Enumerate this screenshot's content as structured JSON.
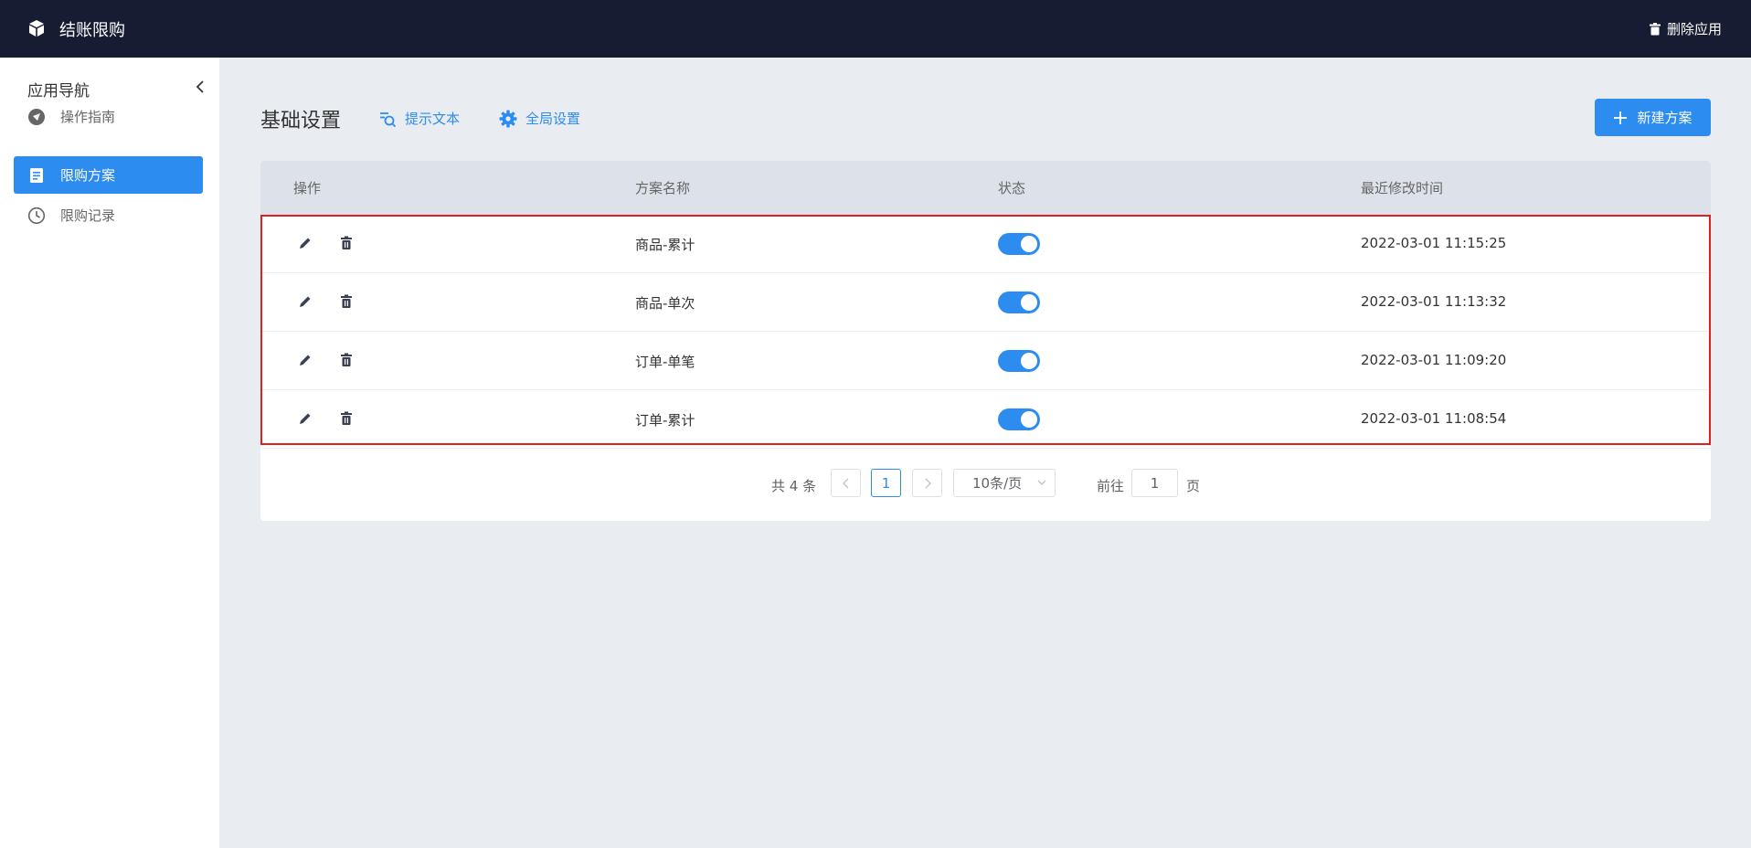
{
  "app": {
    "title": "结账限购",
    "delete_label": "删除应用"
  },
  "sidebar": {
    "title": "应用导航",
    "items": [
      {
        "label": "操作指南",
        "icon": "navigation-icon",
        "active": false
      },
      {
        "label": "限购方案",
        "icon": "document-icon",
        "active": true
      },
      {
        "label": "限购记录",
        "icon": "clock-icon",
        "active": false
      }
    ]
  },
  "header": {
    "title": "基础设置",
    "hint_label": "提示文本",
    "global_label": "全局设置",
    "new_label": "新建方案"
  },
  "table": {
    "columns": [
      "操作",
      "方案名称",
      "状态",
      "最近修改时间"
    ],
    "rows": [
      {
        "name": "商品-累计",
        "enabled": true,
        "time": "2022-03-01 11:15:25"
      },
      {
        "name": "商品-单次",
        "enabled": true,
        "time": "2022-03-01 11:13:32"
      },
      {
        "name": "订单-单笔",
        "enabled": true,
        "time": "2022-03-01 11:09:20"
      },
      {
        "name": "订单-累计",
        "enabled": true,
        "time": "2022-03-01 11:08:54"
      }
    ]
  },
  "pagination": {
    "total": "共 4 条",
    "current": "1",
    "page_size": "10条/页",
    "goto_label": "前往",
    "goto_value": "1",
    "page_unit": "页"
  },
  "colors": {
    "accent": "#2d8cf0",
    "topbar": "#161d33",
    "highlight": "#e02020"
  }
}
